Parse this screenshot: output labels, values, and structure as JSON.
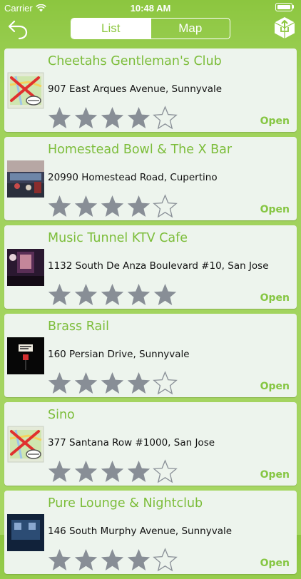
{
  "status_bar": {
    "carrier": "Carrier",
    "time": "10:48 AM"
  },
  "nav": {
    "segments": [
      "List",
      "Map"
    ],
    "active_segment": "List",
    "back_icon": "back-arrow-icon",
    "share_icon": "share-cube-icon"
  },
  "colors": {
    "accent": "#8cc63f",
    "title": "#7cbd3a",
    "star": "#888e96",
    "card": "#edf4ed"
  },
  "venues": [
    {
      "name": "Cheetahs Gentleman's Club",
      "address": "907 East Arques Avenue, Sunnyvale",
      "rating": 4,
      "status": "Open",
      "thumb": "map-placeholder"
    },
    {
      "name": "Homestead Bowl & The X Bar",
      "address": "20990 Homestead Road, Cupertino",
      "rating": 4,
      "status": "Open",
      "thumb": "photo-bowling"
    },
    {
      "name": "Music Tunnel KTV Cafe",
      "address": "1132 South De Anza Boulevard #10, San Jose",
      "rating": 5,
      "status": "Open",
      "thumb": "photo-karaoke"
    },
    {
      "name": "Brass Rail",
      "address": "160 Persian Drive, Sunnyvale",
      "rating": 4,
      "status": "Open",
      "thumb": "photo-sign"
    },
    {
      "name": "Sino",
      "address": "377 Santana Row #1000, San Jose",
      "rating": 4,
      "status": "Open",
      "thumb": "map-placeholder"
    },
    {
      "name": "Pure Lounge & Nightclub",
      "address": "146 South Murphy Avenue, Sunnyvale",
      "rating": 4,
      "status": "Open",
      "thumb": "photo-lounge"
    }
  ]
}
